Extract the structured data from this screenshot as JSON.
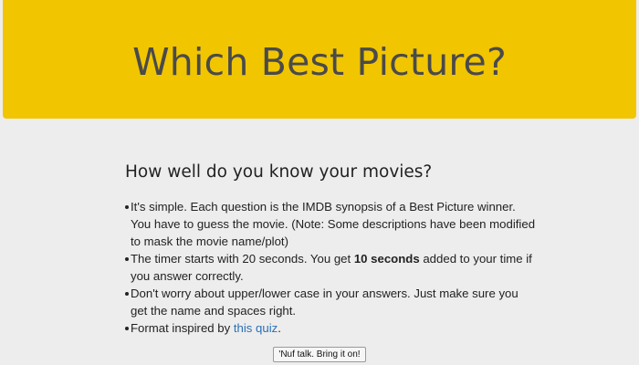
{
  "header": {
    "title": "Which Best Picture?",
    "background_color": "#f1c500"
  },
  "intro": {
    "heading": "How well do you know your movies?",
    "rule1": "It's simple. Each question is the IMDB synopsis of a Best Picture winner. You have to guess the movie. (Note: Some descriptions have been modified to mask the movie name/plot)",
    "rule2_before": "The timer starts with 20 seconds. You get ",
    "rule2_bold": "10 seconds",
    "rule2_after": " added to your time if you answer correctly.",
    "rule3": "Don't worry about upper/lower case in your answers. Just make sure you get the name and spaces right.",
    "rule4_before": "Format inspired by ",
    "rule4_link": "this quiz",
    "rule4_after": "."
  },
  "start_button": {
    "label": "'Nuf talk. Bring it on!"
  },
  "colors": {
    "link": "#2a6fb8",
    "page_background": "#ededed"
  }
}
